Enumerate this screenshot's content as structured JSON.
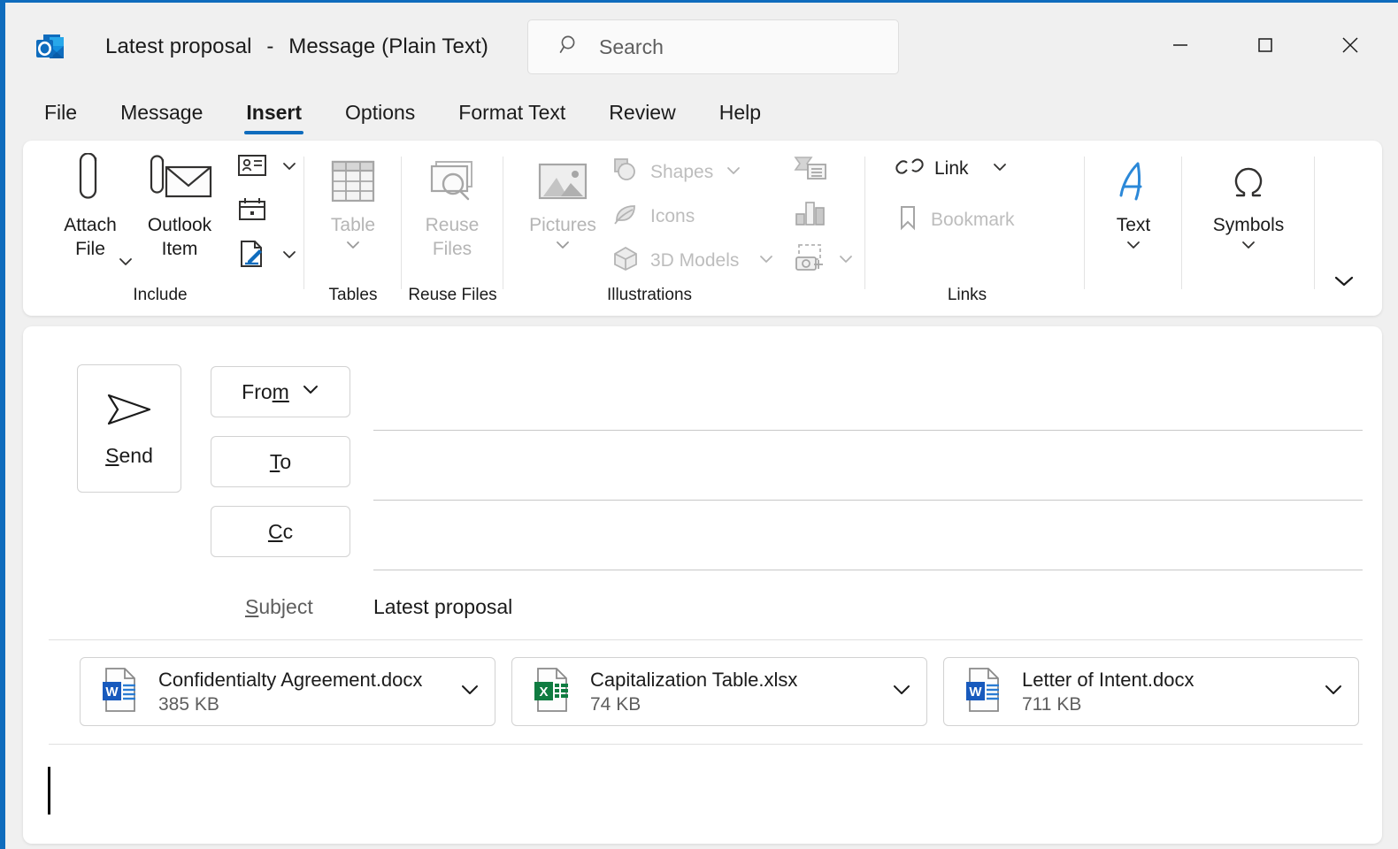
{
  "window": {
    "title_subject": "Latest proposal",
    "title_separator": "-",
    "title_type": "Message (Plain Text)",
    "app_icon": "outlook-icon",
    "accent_color": "#0f6cbd",
    "controls": [
      {
        "name": "minimize",
        "glyph": "minimize-icon"
      },
      {
        "name": "maximize",
        "glyph": "maximize-icon"
      },
      {
        "name": "close",
        "glyph": "close-icon"
      }
    ]
  },
  "search": {
    "placeholder": "Search",
    "icon": "search-icon"
  },
  "tabs": [
    {
      "label": "File",
      "active": false
    },
    {
      "label": "Message",
      "active": false
    },
    {
      "label": "Insert",
      "active": true
    },
    {
      "label": "Options",
      "active": false
    },
    {
      "label": "Format Text",
      "active": false
    },
    {
      "label": "Review",
      "active": false
    },
    {
      "label": "Help",
      "active": false
    }
  ],
  "ribbon": {
    "collapse_icon": "chevron-down-icon",
    "groups": [
      {
        "name": "Include",
        "label": "Include",
        "buttons": [
          {
            "label": "Attach\nFile",
            "icon": "paperclip-icon",
            "has_dropdown": true,
            "disabled": false
          },
          {
            "label": "Outlook\nItem",
            "icon": "outlook-item-icon",
            "has_dropdown": false,
            "disabled": false
          }
        ],
        "small_buttons": [
          {
            "label": "",
            "icon": "business-card-icon",
            "has_dropdown": true,
            "disabled": false
          },
          {
            "label": "",
            "icon": "calendar-icon",
            "has_dropdown": false,
            "disabled": false
          },
          {
            "label": "",
            "icon": "signature-icon",
            "has_dropdown": true,
            "disabled": false
          }
        ]
      },
      {
        "name": "Tables",
        "label": "Tables",
        "buttons": [
          {
            "label": "Table",
            "icon": "table-icon",
            "has_dropdown": true,
            "disabled": true
          }
        ],
        "small_buttons": []
      },
      {
        "name": "Reuse Files",
        "label": "Reuse Files",
        "buttons": [
          {
            "label": "Reuse\nFiles",
            "icon": "reuse-files-icon",
            "has_dropdown": false,
            "disabled": true
          }
        ],
        "small_buttons": []
      },
      {
        "name": "Illustrations",
        "label": "Illustrations",
        "buttons": [
          {
            "label": "Pictures",
            "icon": "pictures-icon",
            "has_dropdown": true,
            "disabled": true
          }
        ],
        "small_buttons": [
          {
            "label": "Shapes",
            "icon": "shapes-icon",
            "has_dropdown": true,
            "disabled": true
          },
          {
            "label": "Icons",
            "icon": "icons-icon",
            "has_dropdown": false,
            "disabled": true
          },
          {
            "label": "3D Models",
            "icon": "3d-models-icon",
            "has_dropdown": true,
            "disabled": true
          },
          {
            "label": "",
            "icon": "smartart-icon",
            "has_dropdown": false,
            "disabled": true
          },
          {
            "label": "",
            "icon": "chart-icon",
            "has_dropdown": false,
            "disabled": true
          },
          {
            "label": "",
            "icon": "screenshot-icon",
            "has_dropdown": true,
            "disabled": true
          }
        ]
      },
      {
        "name": "Links",
        "label": "Links",
        "buttons": [],
        "small_buttons": [
          {
            "label": "Link",
            "icon": "link-icon",
            "has_dropdown": true,
            "disabled": false
          },
          {
            "label": "Bookmark",
            "icon": "bookmark-icon",
            "has_dropdown": false,
            "disabled": true
          }
        ]
      },
      {
        "name": "Text",
        "label": "",
        "buttons": [
          {
            "label": "Text",
            "icon": "text-a-icon",
            "has_dropdown": true,
            "disabled": false
          }
        ],
        "small_buttons": []
      },
      {
        "name": "Symbols",
        "label": "",
        "buttons": [
          {
            "label": "Symbols",
            "icon": "omega-icon",
            "has_dropdown": true,
            "disabled": false
          }
        ],
        "small_buttons": []
      }
    ]
  },
  "compose": {
    "send_button": {
      "label": "Send",
      "icon": "send-arrow-icon"
    },
    "fields": [
      {
        "name": "from",
        "label": "From",
        "value": "",
        "has_dropdown": true
      },
      {
        "name": "to",
        "label": "To",
        "value": "",
        "has_dropdown": false
      },
      {
        "name": "cc",
        "label": "Cc",
        "value": "",
        "has_dropdown": false
      }
    ],
    "subject": {
      "label": "Subject",
      "value": "Latest proposal"
    },
    "body": {
      "value": ""
    },
    "attachments": [
      {
        "filename": "Confidentialty Agreement.docx",
        "size": "385 KB",
        "icon": "word-file-icon",
        "color": "#185abd"
      },
      {
        "filename": "Capitalization Table.xlsx",
        "size": "74 KB",
        "icon": "excel-file-icon",
        "color": "#107c41"
      },
      {
        "filename": "Letter of Intent.docx",
        "size": "711 KB",
        "icon": "word-file-icon",
        "color": "#185abd"
      }
    ]
  }
}
